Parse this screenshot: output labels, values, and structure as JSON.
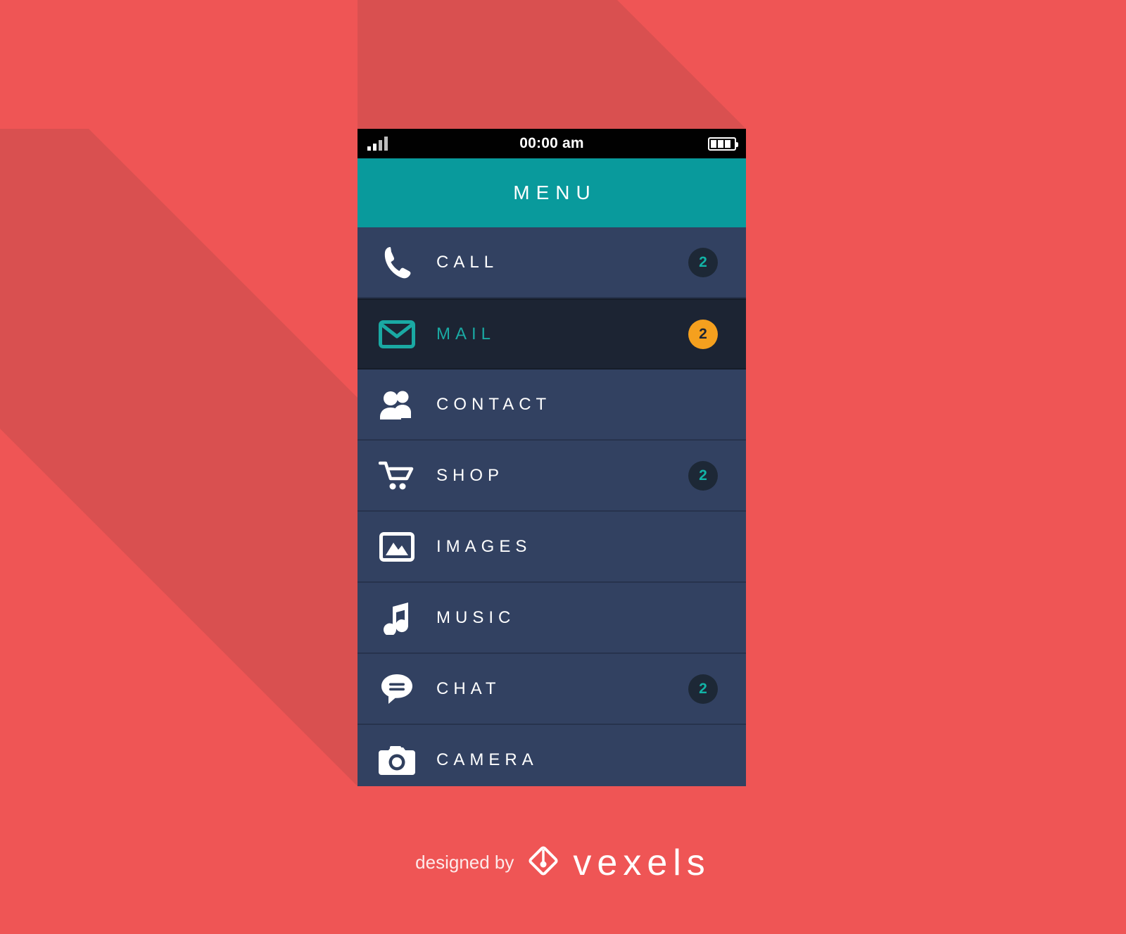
{
  "background": {
    "color": "#ef5555",
    "shadow_color": "#d95050"
  },
  "phone": {
    "status_bar": {
      "time": "00:00 am",
      "signal_icon": "signal-bars-icon",
      "battery_icon": "battery-icon",
      "battery_level_segments": 3,
      "background": "#010101"
    },
    "header": {
      "title": "MENU",
      "color": "#099a9c"
    },
    "menu": {
      "row_color": "#324161",
      "active_row_color": "#1c2433",
      "badge_color": "#1d2836",
      "badge_text_color": "#12b3a6",
      "badge_warn_color": "#f5a01e",
      "items": [
        {
          "label": "CALL",
          "icon": "phone-icon",
          "badge": "2",
          "badge_style": "default",
          "active": false
        },
        {
          "label": "MAIL",
          "icon": "mail-icon",
          "badge": "2",
          "badge_style": "warn",
          "active": true
        },
        {
          "label": "CONTACT",
          "icon": "contacts-icon",
          "badge": "",
          "badge_style": "none",
          "active": false
        },
        {
          "label": "SHOP",
          "icon": "cart-icon",
          "badge": "2",
          "badge_style": "default",
          "active": false
        },
        {
          "label": "IMAGES",
          "icon": "image-icon",
          "badge": "",
          "badge_style": "none",
          "active": false
        },
        {
          "label": "MUSIC",
          "icon": "music-icon",
          "badge": "",
          "badge_style": "none",
          "active": false
        },
        {
          "label": "CHAT",
          "icon": "chat-icon",
          "badge": "2",
          "badge_style": "default",
          "active": false
        },
        {
          "label": "CAMERA",
          "icon": "camera-icon",
          "badge": "",
          "badge_style": "none",
          "active": false
        }
      ]
    }
  },
  "footer": {
    "designed_by": "designed by",
    "brand": "vexels",
    "logo_icon": "vexels-pen-diamond-icon"
  }
}
